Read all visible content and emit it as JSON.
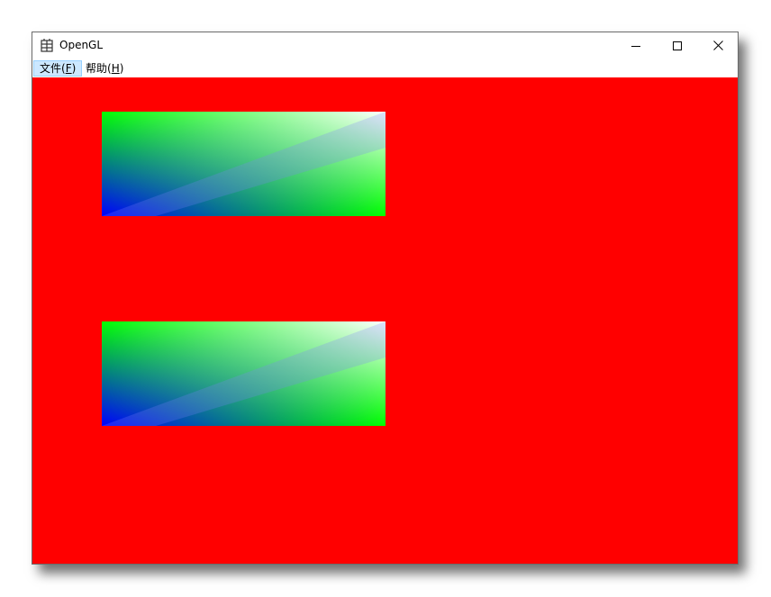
{
  "window": {
    "title": "OpenGL",
    "icon": "window-app-icon",
    "controls": {
      "minimize_icon": "minimize-icon",
      "maximize_icon": "maximize-icon",
      "close_icon": "close-icon"
    }
  },
  "menu": {
    "file": {
      "label": "文件(",
      "mnemonic": "F",
      "suffix": ")"
    },
    "help": {
      "label": "帮助(",
      "mnemonic": "H",
      "suffix": ")"
    }
  },
  "canvas": {
    "background_color": "#ff0000",
    "quads": [
      {
        "corner_colors": {
          "top_left": "#00ff00",
          "top_right": "#ffffff",
          "bottom_left": "#0000ff",
          "bottom_right": "#00ff00"
        }
      },
      {
        "corner_colors": {
          "top_left": "#00ff00",
          "top_right": "#ffffff",
          "bottom_left": "#0000ff",
          "bottom_right": "#00ff00"
        }
      }
    ]
  }
}
